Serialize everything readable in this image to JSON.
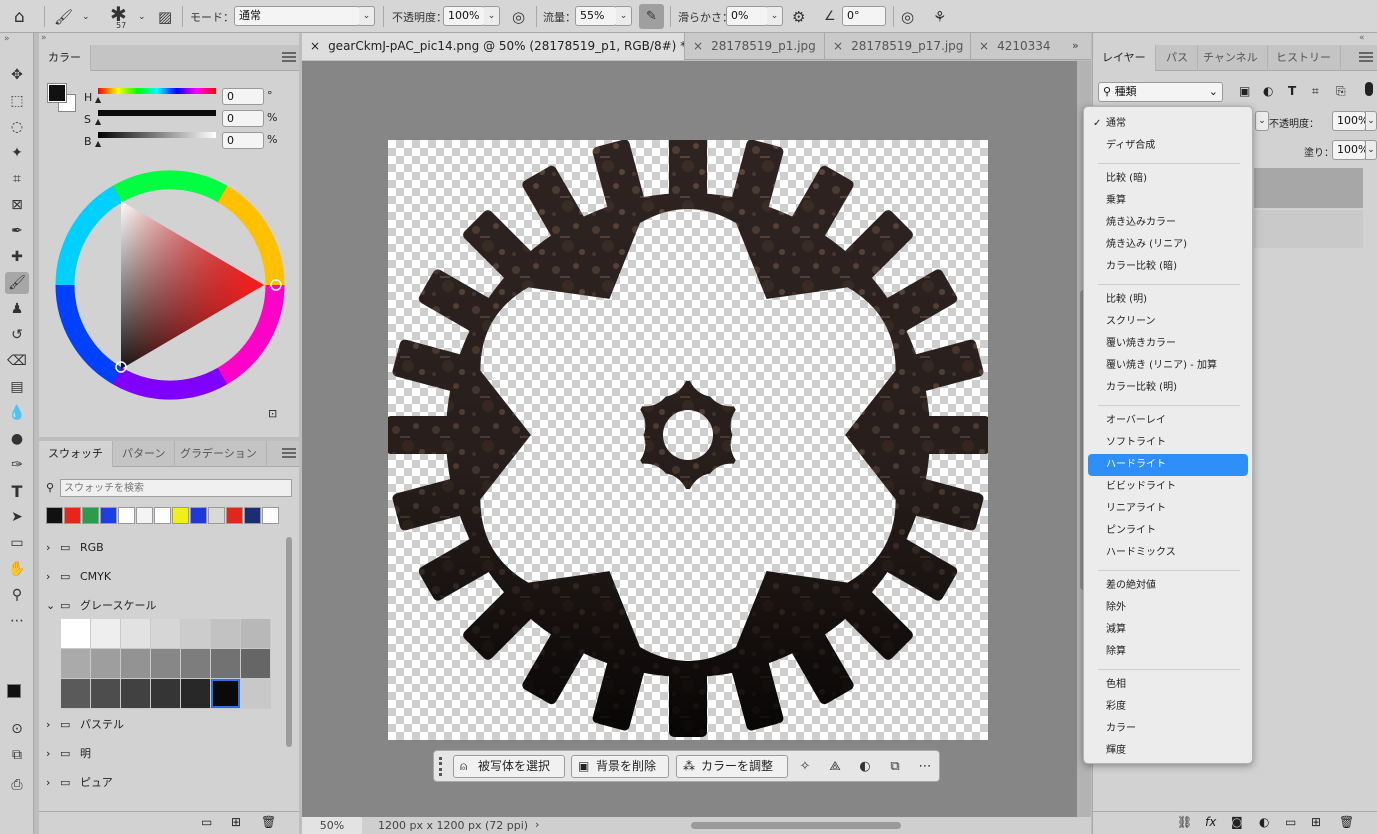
{
  "options_bar": {
    "brush_size": "57",
    "mode_label": "モード：",
    "mode_value": "通常",
    "opacity_label": "不透明度：",
    "opacity_value": "100%",
    "flow_label": "流量：",
    "flow_value": "55%",
    "smoothing_label": "滑らかさ：",
    "smoothing_value": "0%",
    "angle_value": "0°"
  },
  "color_panel": {
    "tab": "カラー",
    "h_label": "H",
    "h_value": "0",
    "h_unit": "°",
    "s_label": "S",
    "s_value": "0",
    "s_unit": "%",
    "b_label": "B",
    "b_value": "0",
    "b_unit": "%"
  },
  "swatch_panel": {
    "tabs": [
      "スウォッチ",
      "パターン",
      "グラデーション"
    ],
    "search_placeholder": "スウォッチを検索",
    "colors": [
      "#111111",
      "#e8251c",
      "#2a9c4a",
      "#1c3fe0",
      "#ffffff",
      "#f4f4f4",
      "#ffffff",
      "#f2ef14",
      "#1d3ad9",
      "#d9d9d9",
      "#e3261d",
      "#1a2e74",
      "#ffffff"
    ],
    "groups": [
      "RGB",
      "CMYK",
      "グレースケール",
      "パステル",
      "明",
      "ピュア"
    ],
    "grays": [
      "#ffffff",
      "#eeeeee",
      "#e2e2e2",
      "#d6d6d6",
      "#cccccc",
      "#c2c2c2",
      "#b8b8b8",
      "#aaaaaa",
      "#9e9e9e",
      "#939393",
      "#878787",
      "#7d7d7d",
      "#727272",
      "#666666",
      "#5a5a5a",
      "#4d4d4d",
      "#414141",
      "#353535",
      "#282828",
      "#0a0a0a"
    ]
  },
  "document_tabs": [
    {
      "label": "gearCkmJ-pAC_pic14.png @ 50% (28178519_p1, RGB/8#) *",
      "active": true
    },
    {
      "label": "28178519_p1.jpg",
      "active": false
    },
    {
      "label": "28178519_p17.jpg",
      "active": false
    },
    {
      "label": "4210334",
      "active": false
    }
  ],
  "status_bar": {
    "zoom": "50%",
    "doc_size": "1200 px x 1200 px (72 ppi)"
  },
  "context_bar": {
    "select_subject": "被写体を選択",
    "remove_bg": "背景を削除",
    "adjust_color": "カラーを調整"
  },
  "layers_panel": {
    "tabs": [
      "レイヤー",
      "パス",
      "チャンネル",
      "ヒストリー"
    ],
    "filter_value": "種類",
    "opacity_label": "不透明度：",
    "opacity_value": "100%",
    "fill_label": "塗り：",
    "fill_value": "100%"
  },
  "blend_menu": {
    "groups": [
      [
        "通常",
        "ディザ合成"
      ],
      [
        "比較 (暗)",
        "乗算",
        "焼き込みカラー",
        "焼き込み (リニア)",
        "カラー比較 (暗)"
      ],
      [
        "比較 (明)",
        "スクリーン",
        "覆い焼きカラー",
        "覆い焼き (リニア) - 加算",
        "カラー比較 (明)"
      ],
      [
        "オーバーレイ",
        "ソフトライト",
        "ハードライト",
        "ビビッドライト",
        "リニアライト",
        "ピンライト",
        "ハードミックス"
      ],
      [
        "差の絶対値",
        "除外",
        "減算",
        "除算"
      ],
      [
        "色相",
        "彩度",
        "カラー",
        "輝度"
      ]
    ],
    "checked": "通常",
    "highlighted": "ハードライト"
  }
}
